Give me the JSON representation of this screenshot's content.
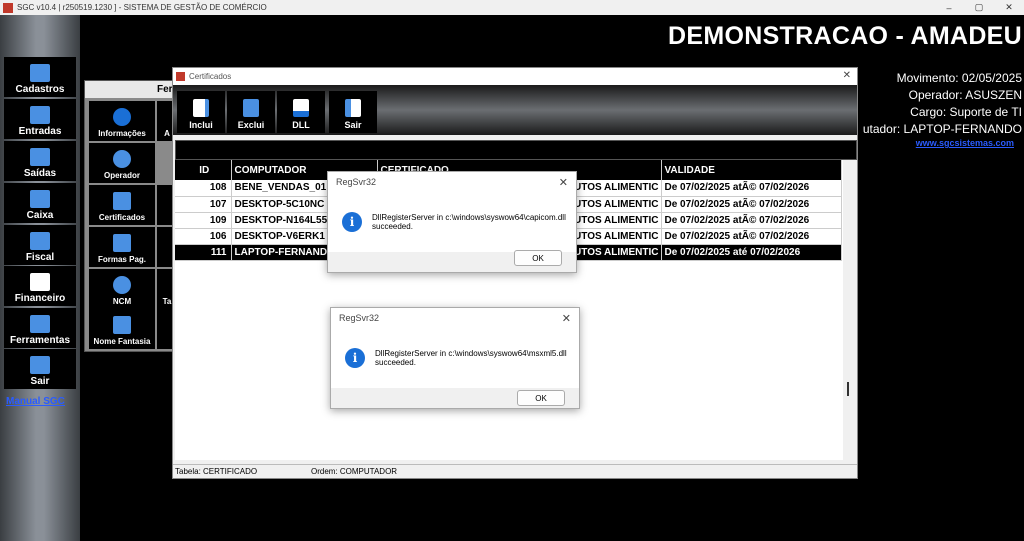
{
  "window": {
    "title": "SGC v10.4 | r250519.1230 ] - SISTEMA DE GESTÃO DE COMÉRCIO",
    "controls": [
      "–",
      "▢",
      "✕"
    ]
  },
  "sidebar": {
    "items": [
      {
        "label": "Cadastros",
        "icon": "database-icon",
        "color": "#4a90e2"
      },
      {
        "label": "Entradas",
        "icon": "truck-icon",
        "color": "#4a90e2"
      },
      {
        "label": "Saídas",
        "icon": "cart-icon",
        "color": "#4a90e2"
      },
      {
        "label": "Caixa",
        "icon": "cash-register-icon",
        "color": "#4a90e2"
      },
      {
        "label": "Fiscal",
        "icon": "document-icon",
        "color": "#4a90e2"
      },
      {
        "label": "Financeiro",
        "icon": "document-icon",
        "color": "#ffffff"
      },
      {
        "label": "Ferramentas",
        "icon": "tools-icon",
        "color": "#4a90e2"
      },
      {
        "label": "Sair",
        "icon": "exit-icon",
        "color": "#4a90e2"
      }
    ],
    "manual_link": "Manual SGC"
  },
  "header": {
    "title": "DEMONSTRACAO - AMADEU",
    "movimento": "Movimento: 02/05/2025",
    "operador": "Operador: ASUSZEN",
    "cargo": "Cargo: Suporte de TI",
    "computador": "utador: LAPTOP-FERNANDO",
    "site": "www.sgcsistemas.com"
  },
  "bg_panel": {
    "header": "Fer",
    "items": [
      {
        "label": "Informações",
        "icon": "info-icon"
      },
      {
        "label": "Operador",
        "icon": "user-icon"
      },
      {
        "label": "Certificados",
        "icon": "certificate-icon"
      },
      {
        "label": "Formas Pag.",
        "icon": "payment-icon"
      },
      {
        "label": "NCM",
        "icon": "database-icon"
      },
      {
        "label": "Nome Fantasia",
        "icon": "id-card-icon"
      }
    ],
    "side_letters": [
      "A",
      "",
      "",
      "",
      "Ta",
      ""
    ]
  },
  "cert_window": {
    "title": "Certificados",
    "toolbar": [
      {
        "label": "Inclui",
        "icon": "add-file-icon"
      },
      {
        "label": "Exclui",
        "icon": "trash-icon"
      },
      {
        "label": "DLL",
        "icon": "dll-file-icon"
      },
      {
        "label": "Sair",
        "icon": "exit-icon"
      }
    ],
    "columns": [
      "ID",
      "COMPUTADOR",
      "CERTIFICADO",
      "VALIDADE"
    ],
    "rows": [
      {
        "id": "108",
        "computador": "BENE_VENDAS_01",
        "certificado": "UTOS ALIMENTIC",
        "validade": "De 07/02/2025 atÃ© 07/02/2026",
        "selected": false
      },
      {
        "id": "107",
        "computador": "DESKTOP-5C10NC",
        "certificado": "UTOS ALIMENTIC",
        "validade": "De 07/02/2025 atÃ© 07/02/2026",
        "selected": false
      },
      {
        "id": "109",
        "computador": "DESKTOP-N164L55",
        "certificado": "UTOS ALIMENTIC",
        "validade": "De 07/02/2025 atÃ© 07/02/2026",
        "selected": false
      },
      {
        "id": "106",
        "computador": "DESKTOP-V6ERK1",
        "certificado": "UTOS ALIMENTIC",
        "validade": "De 07/02/2025 atÃ© 07/02/2026",
        "selected": false
      },
      {
        "id": "111",
        "computador": "LAPTOP-FERNAND",
        "certificado": "UTOS ALIMENTIC",
        "validade": "De 07/02/2025 até 07/02/2026",
        "selected": true
      }
    ],
    "status_table": "Tabela: CERTIFICADO",
    "status_order": "Ordem: COMPUTADOR"
  },
  "dialogs": [
    {
      "title": "RegSvr32",
      "line1": "DllRegisterServer in c:\\windows\\syswow64\\capicom.dll",
      "line2": "succeeded.",
      "ok": "OK"
    },
    {
      "title": "RegSvr32",
      "line1": "DllRegisterServer in c:\\windows\\syswow64\\msxml5.dll",
      "line2": "succeeded.",
      "ok": "OK"
    }
  ]
}
